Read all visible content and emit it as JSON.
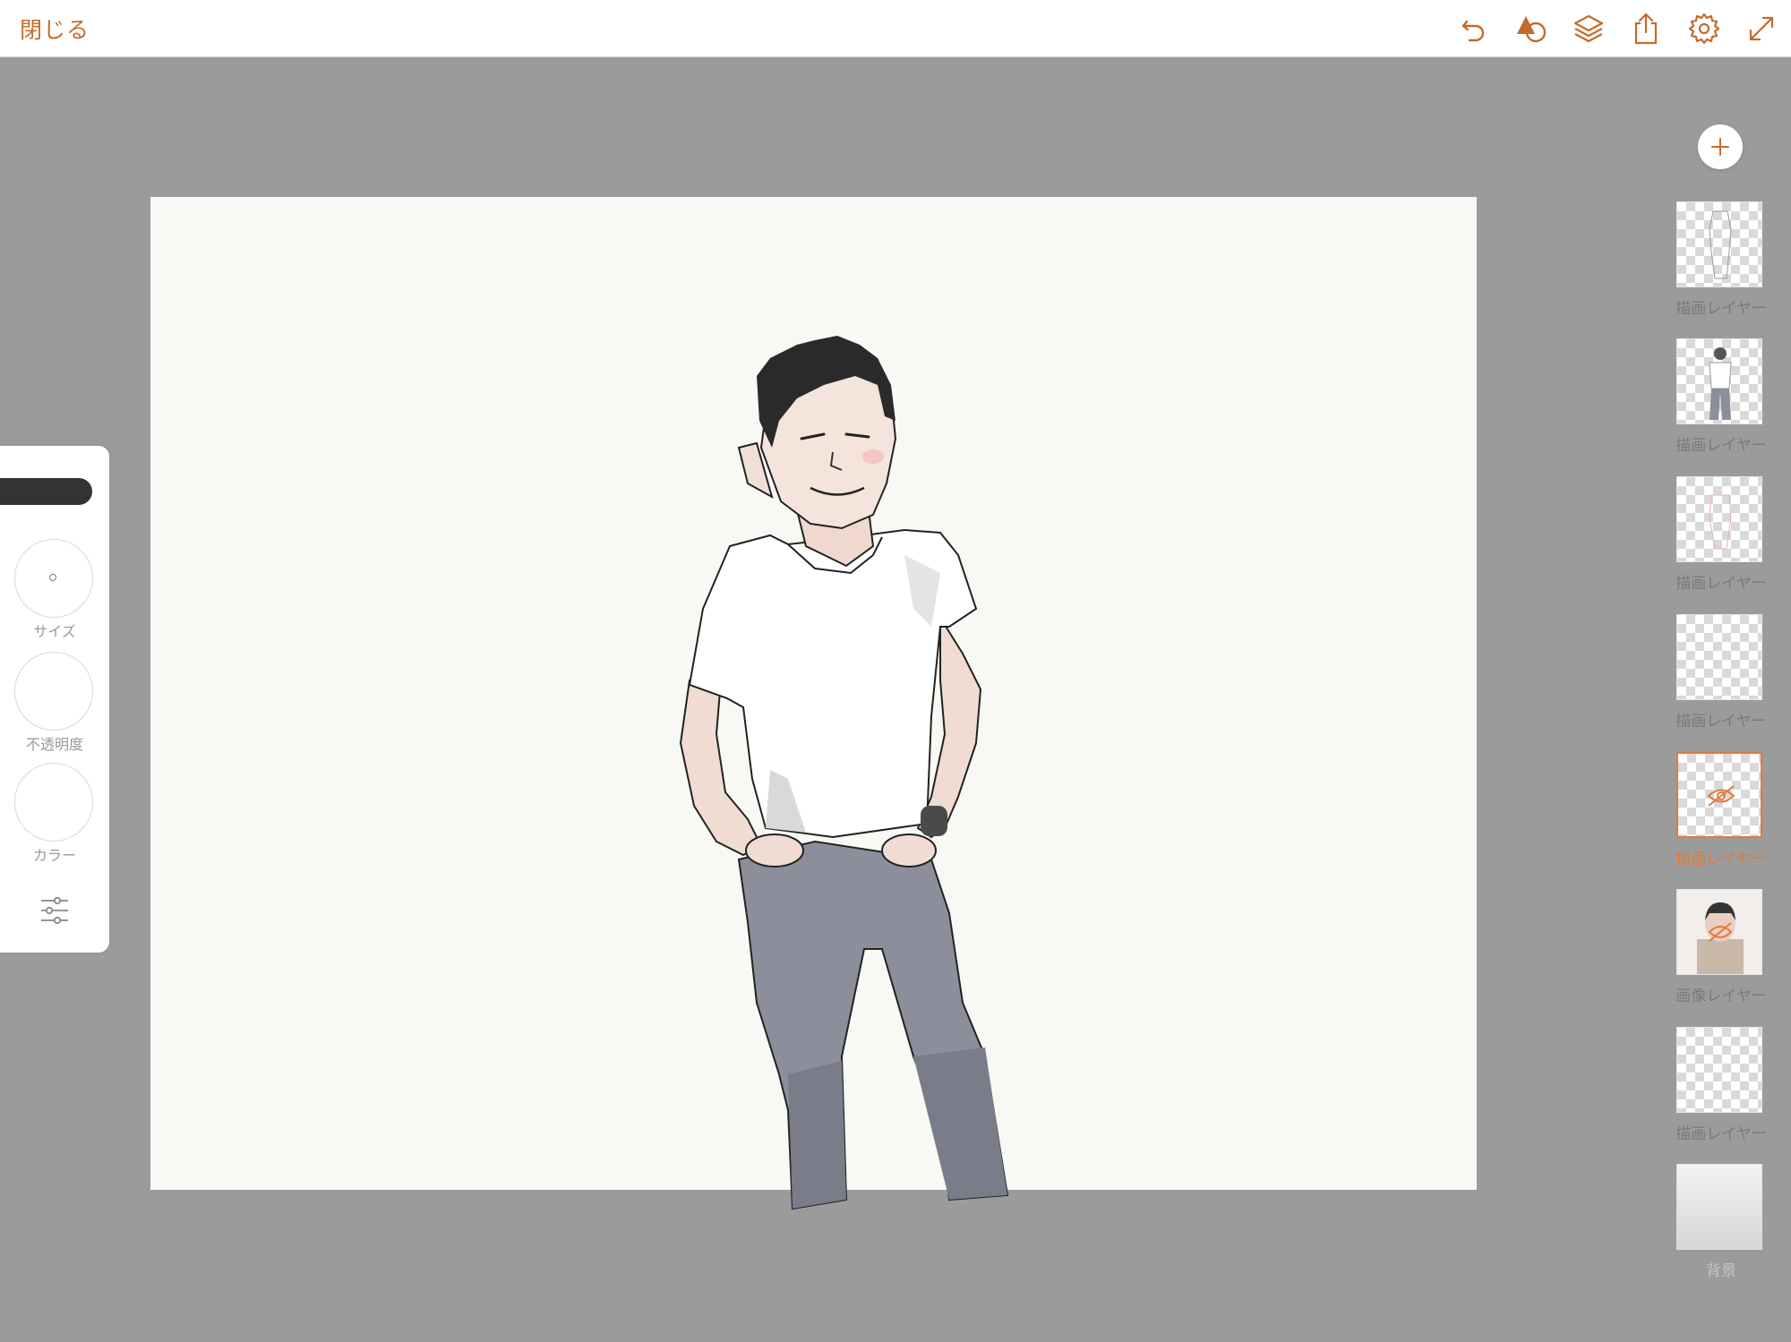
{
  "topbar": {
    "close_label": "閉じる",
    "icons": [
      "undo-icon",
      "shapes-icon",
      "layers-icon",
      "share-icon",
      "settings-gear-icon",
      "fullscreen-icon"
    ],
    "accent_color": "#c46a2a"
  },
  "tool_panel": {
    "size_label": "サイズ",
    "opacity_label": "不透明度",
    "color_label": "カラー",
    "brush_color": "#333333"
  },
  "layers": {
    "add_icon": "plus-icon",
    "items": [
      {
        "label": "描画レイヤー",
        "active": false,
        "hidden": false
      },
      {
        "label": "描画レイヤー",
        "active": false,
        "hidden": false
      },
      {
        "label": "描画レイヤー",
        "active": false,
        "hidden": false
      },
      {
        "label": "描画レイヤー",
        "active": false,
        "hidden": false
      },
      {
        "label": "描画レイヤー",
        "active": true,
        "hidden": true
      },
      {
        "label": "画像レイヤー",
        "active": false,
        "hidden": true
      },
      {
        "label": "描画レイヤー",
        "active": false,
        "hidden": false
      },
      {
        "label": "背景",
        "active": false,
        "hidden": false
      }
    ],
    "active_color": "#e07a3c"
  }
}
